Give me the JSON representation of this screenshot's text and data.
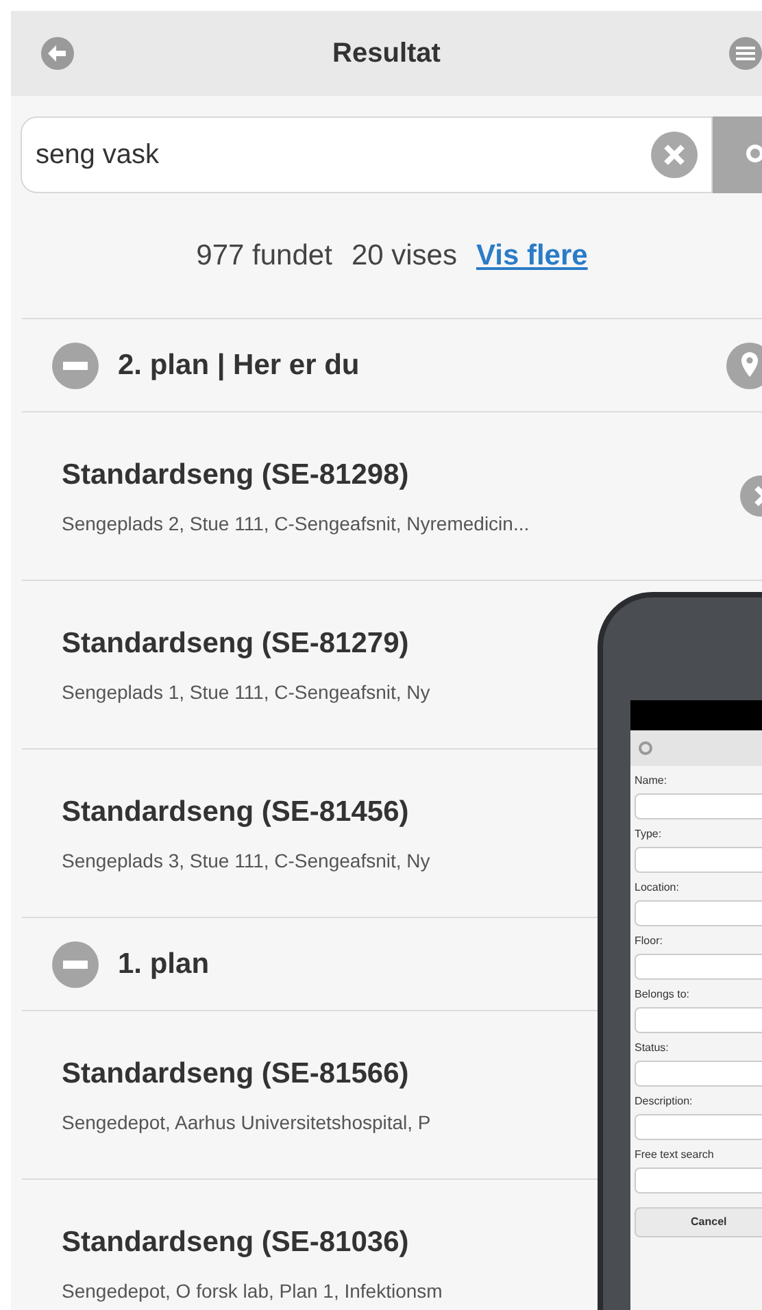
{
  "header": {
    "title": "Resultat"
  },
  "search": {
    "value": "seng vask"
  },
  "summary": {
    "found": "977 fundet",
    "shown": "20 vises",
    "more_link": "Vis flere"
  },
  "groups": [
    {
      "title": "2. plan | Her er du",
      "expanded": true,
      "location_marker": true,
      "items": [
        {
          "title": "Standardseng (SE-81298)",
          "subtitle": "Sengeplads 2, Stue 111, C-Sengeafsnit, Nyremedicin...",
          "chevron": true
        },
        {
          "title": "Standardseng (SE-81279)",
          "subtitle": "Sengeplads 1, Stue 111, C-Sengeafsnit, Ny",
          "chevron": false
        },
        {
          "title": "Standardseng (SE-81456)",
          "subtitle": "Sengeplads 3, Stue 111, C-Sengeafsnit, Ny",
          "chevron": false
        }
      ]
    },
    {
      "title": "1. plan",
      "expanded": true,
      "location_marker": false,
      "items": [
        {
          "title": "Standardseng (SE-81566)",
          "subtitle": "Sengedepot, Aarhus Universitetshospital, P",
          "chevron": false
        },
        {
          "title": "Standardseng (SE-81036)",
          "subtitle": "Sengedepot, O forsk lab, Plan 1, Infektionsm",
          "chevron": false
        }
      ]
    }
  ],
  "phone_inset": {
    "fields": [
      "Name:",
      "Type:",
      "Location:",
      "Floor:",
      "Belongs to:",
      "Status:",
      "Description:",
      "Free text search"
    ],
    "cancel_button": "Cancel"
  }
}
